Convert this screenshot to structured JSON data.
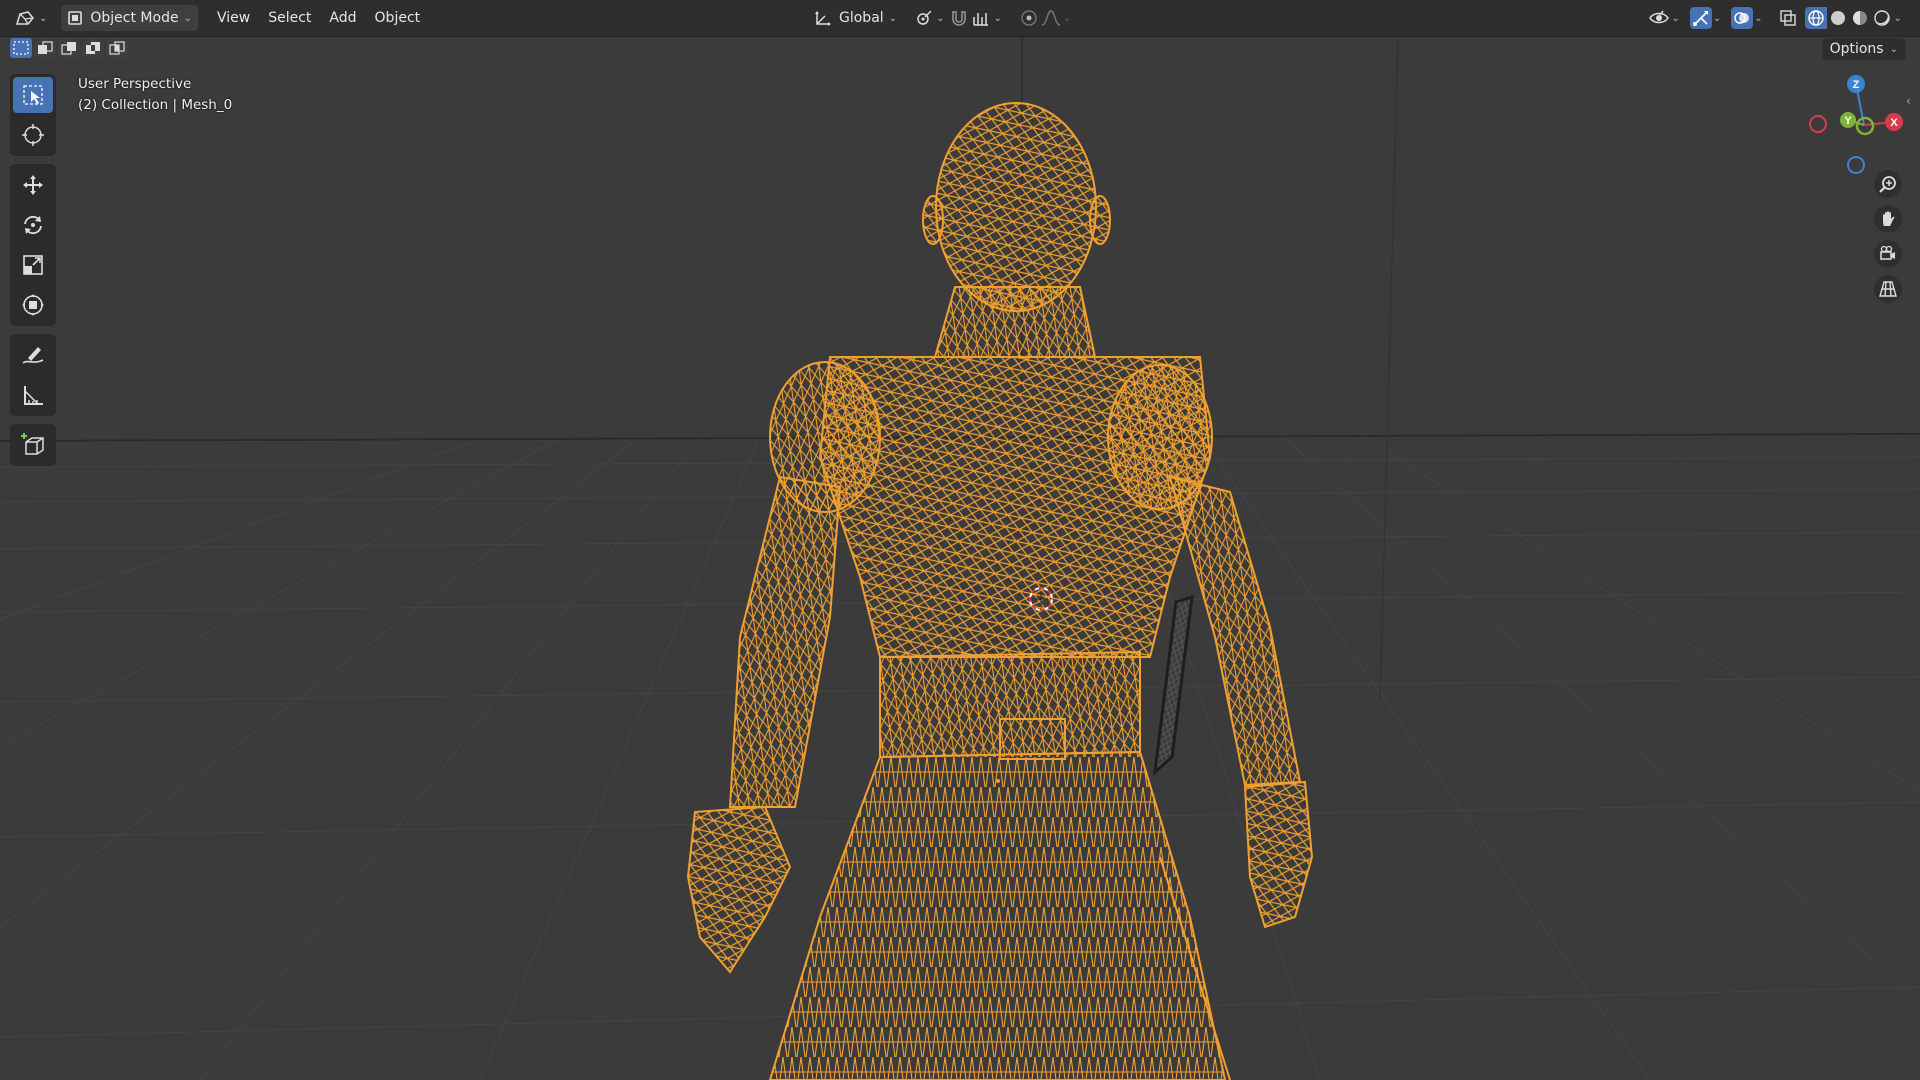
{
  "header": {
    "editor_type_icon": "editor-type-icon",
    "mode_label": "Object Mode",
    "menus": [
      "View",
      "Select",
      "Add",
      "Object"
    ],
    "transform_orientation": "Global",
    "right_icons": [
      "visibility-icon",
      "gizmo-icon",
      "overlay-icon",
      "xray-icon",
      "wireframe-icon",
      "solid-icon",
      "material-icon",
      "rendered-icon"
    ]
  },
  "toolbar_header": {
    "options_label": "Options"
  },
  "viewport": {
    "perspective_label": "User Perspective",
    "collection_label": "(2) Collection | Mesh_0"
  },
  "gizmo": {
    "z_label": "Z",
    "y_label": "Y",
    "x_label": "X"
  },
  "tools": [
    "select-box",
    "cursor",
    "move",
    "rotate",
    "scale",
    "transform",
    "annotate",
    "measure",
    "add-cube"
  ],
  "colors": {
    "accent": "#4772b3",
    "wire": "#f0a030",
    "header_bg": "#2e2e2e",
    "viewport_bg": "#3b3b3b",
    "axis_x": "#d63c4a",
    "axis_y": "#7db33a",
    "axis_z": "#3e82d6"
  }
}
